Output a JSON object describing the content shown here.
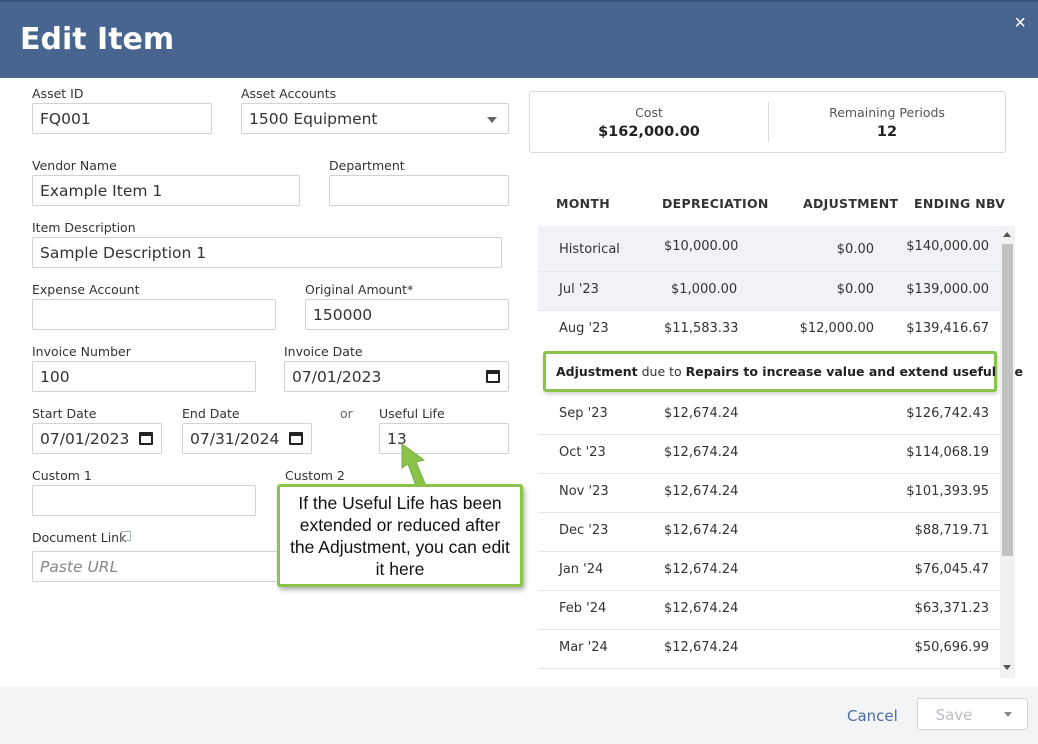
{
  "header": {
    "title": "Edit Item",
    "close_icon": "×"
  },
  "form": {
    "asset_id": {
      "label": "Asset ID",
      "value": "FQ001"
    },
    "asset_accounts": {
      "label": "Asset Accounts",
      "value": "1500 Equipment"
    },
    "vendor_name": {
      "label": "Vendor Name",
      "value": "Example Item 1"
    },
    "department": {
      "label": "Department",
      "value": ""
    },
    "item_description": {
      "label": "Item Description",
      "value": "Sample Description 1"
    },
    "expense_account": {
      "label": "Expense Account",
      "value": ""
    },
    "original_amount": {
      "label": "Original Amount*",
      "value": "150000"
    },
    "invoice_number": {
      "label": "Invoice Number",
      "value": "100"
    },
    "invoice_date": {
      "label": "Invoice Date",
      "value": "07/01/2023"
    },
    "start_date": {
      "label": "Start Date",
      "value": "07/01/2023"
    },
    "end_date": {
      "label": "End Date",
      "value": "07/31/2024"
    },
    "or_text": "or",
    "useful_life": {
      "label": "Useful Life",
      "value": "13"
    },
    "custom1": {
      "label": "Custom 1",
      "value": ""
    },
    "custom2": {
      "label": "Custom 2",
      "value": ""
    },
    "document_link": {
      "label": "Document Link",
      "placeholder": "Paste URL"
    }
  },
  "summary": {
    "cost": {
      "label": "Cost",
      "value": "$162,000.00"
    },
    "remaining": {
      "label": "Remaining Periods",
      "value": "12"
    }
  },
  "table": {
    "headers": {
      "month": "MONTH",
      "depreciation": "DEPRECIATION",
      "adjustment": "ADJUSTMENT",
      "ending_nbv": "ENDING NBV"
    },
    "rows": [
      {
        "month": "Historical",
        "depreciation": "$10,000.00",
        "adjustment": "$0.00",
        "nbv": "$140,000.00"
      },
      {
        "month": "Jul '23",
        "depreciation": "$1,000.00",
        "adjustment": "$0.00",
        "nbv": "$139,000.00"
      },
      {
        "month": "Aug '23",
        "depreciation": "$11,583.33",
        "adjustment": "$12,000.00",
        "nbv": "$139,416.67"
      },
      {
        "month": "Sep '23",
        "depreciation": "$12,674.24",
        "adjustment": "",
        "nbv": "$126,742.43"
      },
      {
        "month": "Oct '23",
        "depreciation": "$12,674.24",
        "adjustment": "",
        "nbv": "$114,068.19"
      },
      {
        "month": "Nov '23",
        "depreciation": "$12,674.24",
        "adjustment": "",
        "nbv": "$101,393.95"
      },
      {
        "month": "Dec '23",
        "depreciation": "$12,674.24",
        "adjustment": "",
        "nbv": "$88,719.71"
      },
      {
        "month": "Jan '24",
        "depreciation": "$12,674.24",
        "adjustment": "",
        "nbv": "$76,045.47"
      },
      {
        "month": "Feb '24",
        "depreciation": "$12,674.24",
        "adjustment": "",
        "nbv": "$63,371.23"
      },
      {
        "month": "Mar '24",
        "depreciation": "$12,674.24",
        "adjustment": "",
        "nbv": "$50,696.99"
      }
    ],
    "note": {
      "word1": "Adjustment",
      "mid": " due to ",
      "reason": "Repairs to increase value and extend useful life"
    }
  },
  "callout": {
    "text": "If the Useful Life has been extended or reduced after the Adjustment, you can edit it here"
  },
  "footer": {
    "cancel_label": "Cancel",
    "save_label": "Save"
  },
  "colors": {
    "header_bg": "#486590",
    "highlight": "#8bc34a",
    "link": "#4a6da7"
  }
}
